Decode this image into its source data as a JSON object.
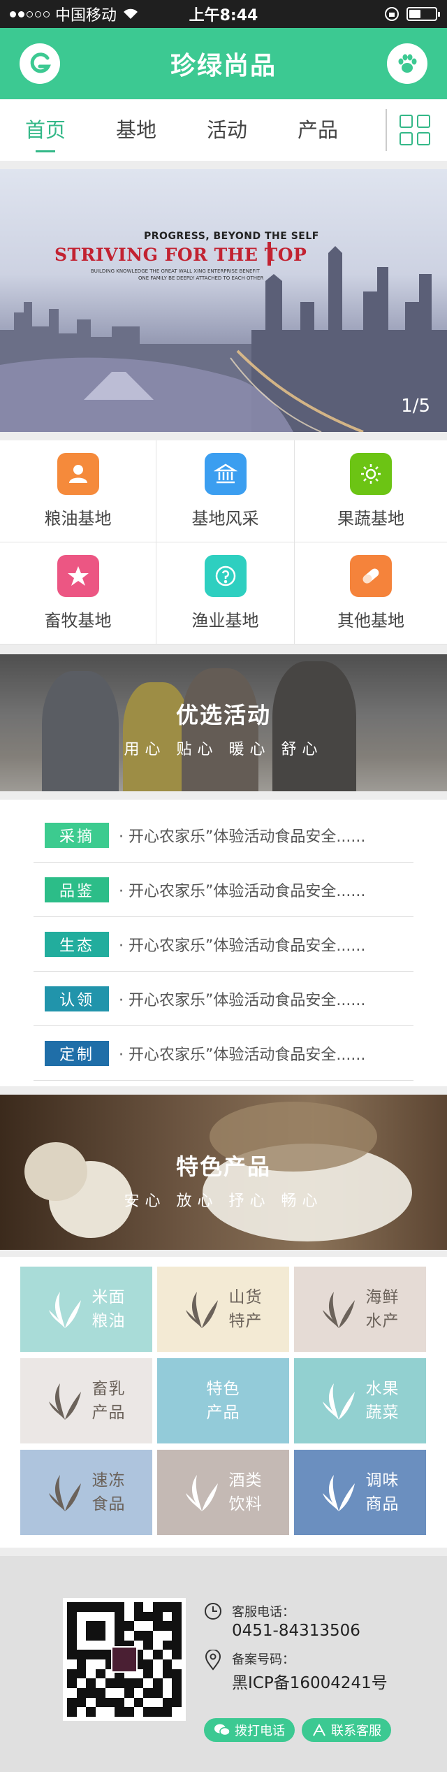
{
  "status_bar": {
    "carrier": "中国移动",
    "time": "上午8:44"
  },
  "header": {
    "title": "珍绿尚品"
  },
  "tabs": [
    {
      "label": "首页",
      "active": true
    },
    {
      "label": "基地",
      "active": false
    },
    {
      "label": "活动",
      "active": false
    },
    {
      "label": "产品",
      "active": false
    }
  ],
  "banner": {
    "headline_top": "PROGRESS, BEYOND THE SELF",
    "headline_main": "STRIVING FOR THE TOP",
    "sub1": "BUILDING KNOWLEDGE THE GREAT WALL XING ENTERPRISE BENEFIT",
    "sub2": "ONE FAMILY BE DEEPLY ATTACHED TO EACH OTHER",
    "counter": "1/5"
  },
  "categories": [
    {
      "label": "粮油基地",
      "icon": "person-icon",
      "color": "#f58a3b"
    },
    {
      "label": "基地风采",
      "icon": "building-icon",
      "color": "#3b9ef0"
    },
    {
      "label": "果蔬基地",
      "icon": "sun-icon",
      "color": "#6cc414"
    },
    {
      "label": "畜牧基地",
      "icon": "star-icon",
      "color": "#ec5683"
    },
    {
      "label": "渔业基地",
      "icon": "question-icon",
      "color": "#2ecfc0"
    },
    {
      "label": "其他基地",
      "icon": "pill-icon",
      "color": "#f5833b"
    }
  ],
  "activity_banner": {
    "title": "优选活动",
    "subtitle": "用心 贴心 暖心 舒心"
  },
  "activities": [
    {
      "tag": "采摘",
      "color": "#3ccb8f",
      "text": "· 开心农家乐”体验活动食品安全......"
    },
    {
      "tag": "品鉴",
      "color": "#2cbd88",
      "text": "· 开心农家乐”体验活动食品安全......"
    },
    {
      "tag": "生态",
      "color": "#22ad9d",
      "text": "· 开心农家乐”体验活动食品安全......"
    },
    {
      "tag": "认领",
      "color": "#2194ab",
      "text": "· 开心农家乐”体验活动食品安全......"
    },
    {
      "tag": "定制",
      "color": "#1f6ea8",
      "text": "· 开心农家乐”体验活动食品安全......"
    }
  ],
  "product_banner": {
    "title": "特色产品",
    "subtitle": "安心 放心 抒心 畅心"
  },
  "products": [
    {
      "line1": "米面",
      "line2": "粮油",
      "color": "#a9dcd8",
      "text_color": "#ffffff",
      "leaf": true
    },
    {
      "line1": "山货",
      "line2": "特产",
      "color": "#f3ead4",
      "text_color": "#6b625a",
      "leaf": true
    },
    {
      "line1": "海鲜",
      "line2": "水产",
      "color": "#e5dbd5",
      "text_color": "#6b625a",
      "leaf": true
    },
    {
      "line1": "畜乳",
      "line2": "产品",
      "color": "#ebe7e5",
      "text_color": "#6b625a",
      "leaf": true
    },
    {
      "line1": "特色",
      "line2": "产品",
      "color": "#93cbd9",
      "text_color": "#ffffff",
      "leaf": false
    },
    {
      "line1": "水果",
      "line2": "蔬菜",
      "color": "#92d0d0",
      "text_color": "#ffffff",
      "leaf": true
    },
    {
      "line1": "速冻",
      "line2": "食品",
      "color": "#aec4dd",
      "text_color": "#6b625a",
      "leaf": true
    },
    {
      "line1": "酒类",
      "line2": "饮料",
      "color": "#c4b9b4",
      "text_color": "#ffffff",
      "leaf": true
    },
    {
      "line1": "调味",
      "line2": "商品",
      "color": "#6b8fbf",
      "text_color": "#ffffff",
      "leaf": true
    }
  ],
  "footer": {
    "service_label": "客服电话：",
    "service_phone": "0451-84313506",
    "icp_label": "备案号码：",
    "icp_number": "黑ICP备16004241号",
    "call_button": "拨打电话",
    "contact_button": "联系客服"
  }
}
